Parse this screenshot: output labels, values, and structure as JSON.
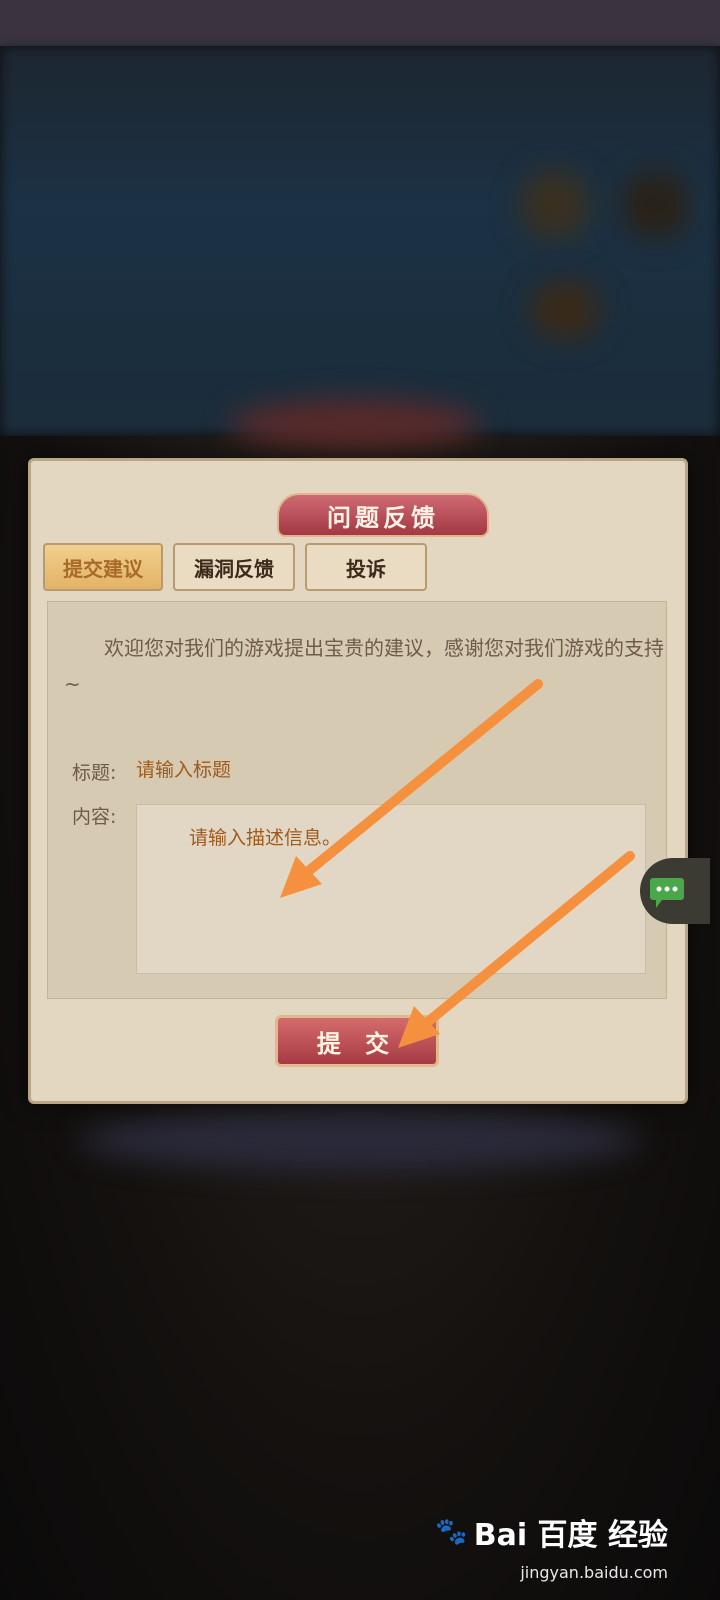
{
  "dialog": {
    "title": "问题反馈",
    "tabs": [
      {
        "label": "提交建议",
        "active": true
      },
      {
        "label": "漏洞反馈",
        "active": false
      },
      {
        "label": "投诉",
        "active": false
      }
    ],
    "welcome_text": "欢迎您对我们的游戏提出宝贵的建议，感谢您对我们游戏的支持~",
    "title_label": "标题:",
    "title_placeholder": "请输入标题",
    "content_label": "内容:",
    "content_placeholder": "请输入描述信息。",
    "submit_label": "提 交"
  },
  "watermark": {
    "brand": "Bai 百度 经验",
    "url": "jingyan.baidu.com"
  },
  "colors": {
    "accent_red": "#a73a45",
    "annotation_orange": "#f5913e",
    "placeholder_text": "#a05a1a"
  }
}
